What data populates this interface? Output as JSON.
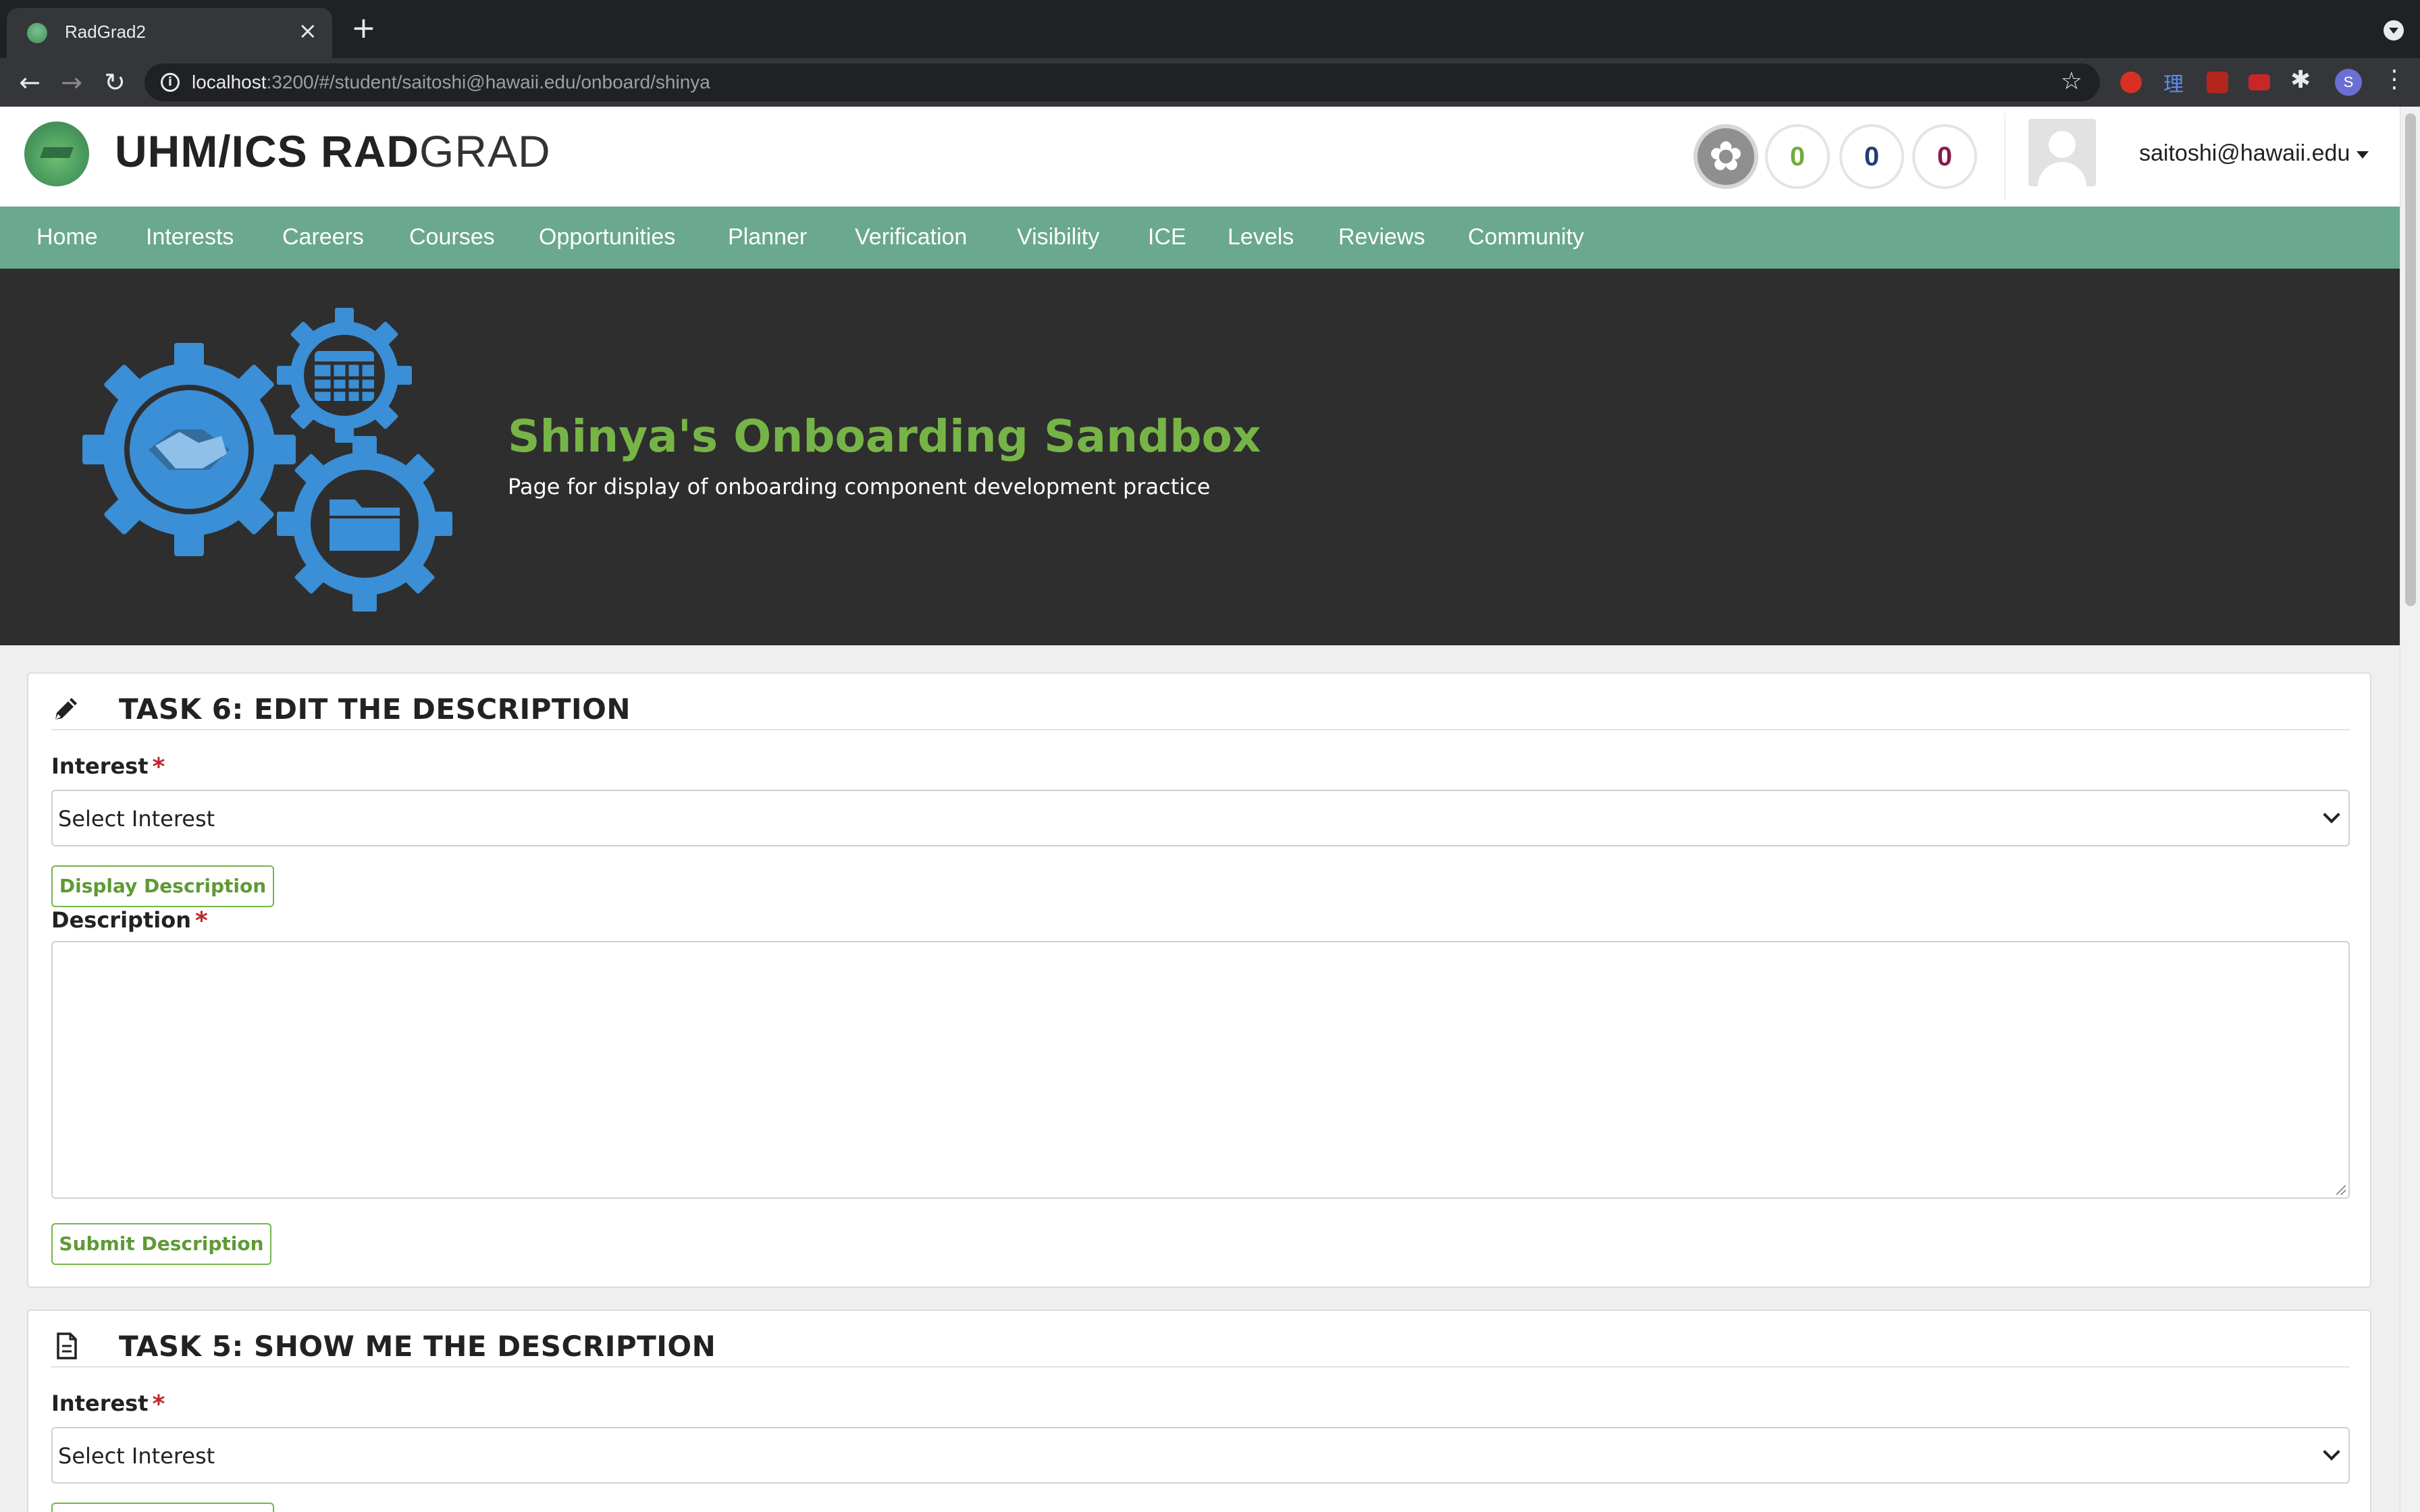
{
  "browser": {
    "tab_title": "RadGrad2",
    "tab_close": "×",
    "new_tab": "+",
    "url_host": "localhost",
    "url_rest": ":3200/#/student/saitoshi@hawaii.edu/onboard/shinya",
    "profile_initial": "S",
    "icons": [
      "back-icon",
      "forward-icon",
      "reload-icon",
      "info-icon",
      "star-icon",
      "puzzle-icon",
      "kebab-icon"
    ]
  },
  "header": {
    "brand_bold": "UHM/ICS RAD",
    "brand_light": "GRAD",
    "ice": {
      "i": "0",
      "c": "0",
      "e": "0"
    },
    "user": "saitoshi@hawaii.edu"
  },
  "nav": {
    "items": [
      "Home",
      "Interests",
      "Careers",
      "Courses",
      "Opportunities",
      "Planner",
      "Verification",
      "Visibility",
      "ICE",
      "Levels",
      "Reviews",
      "Community"
    ]
  },
  "banner": {
    "title": "Shinya's Onboarding Sandbox",
    "subtitle": "Page for display of onboarding component development practice"
  },
  "task6": {
    "title": "TASK 6: EDIT THE DESCRIPTION",
    "interest_label": "Interest",
    "required_mark": "*",
    "interest_value": "Select Interest",
    "display_button": "Display Description",
    "description_label": "Description",
    "description_value": "",
    "submit_button": "Submit Description"
  },
  "task5": {
    "title": "TASK 5: SHOW ME THE DESCRIPTION",
    "interest_label": "Interest",
    "required_mark": "*",
    "interest_value": "Select Interest"
  },
  "colors": {
    "nav_bg": "#6aa88f",
    "banner_title": "#76b447",
    "ice_i": "#6fae3c",
    "ice_c": "#1f3f77",
    "ice_e": "#8b1a4a",
    "gear_blue": "#3b8fd6"
  }
}
